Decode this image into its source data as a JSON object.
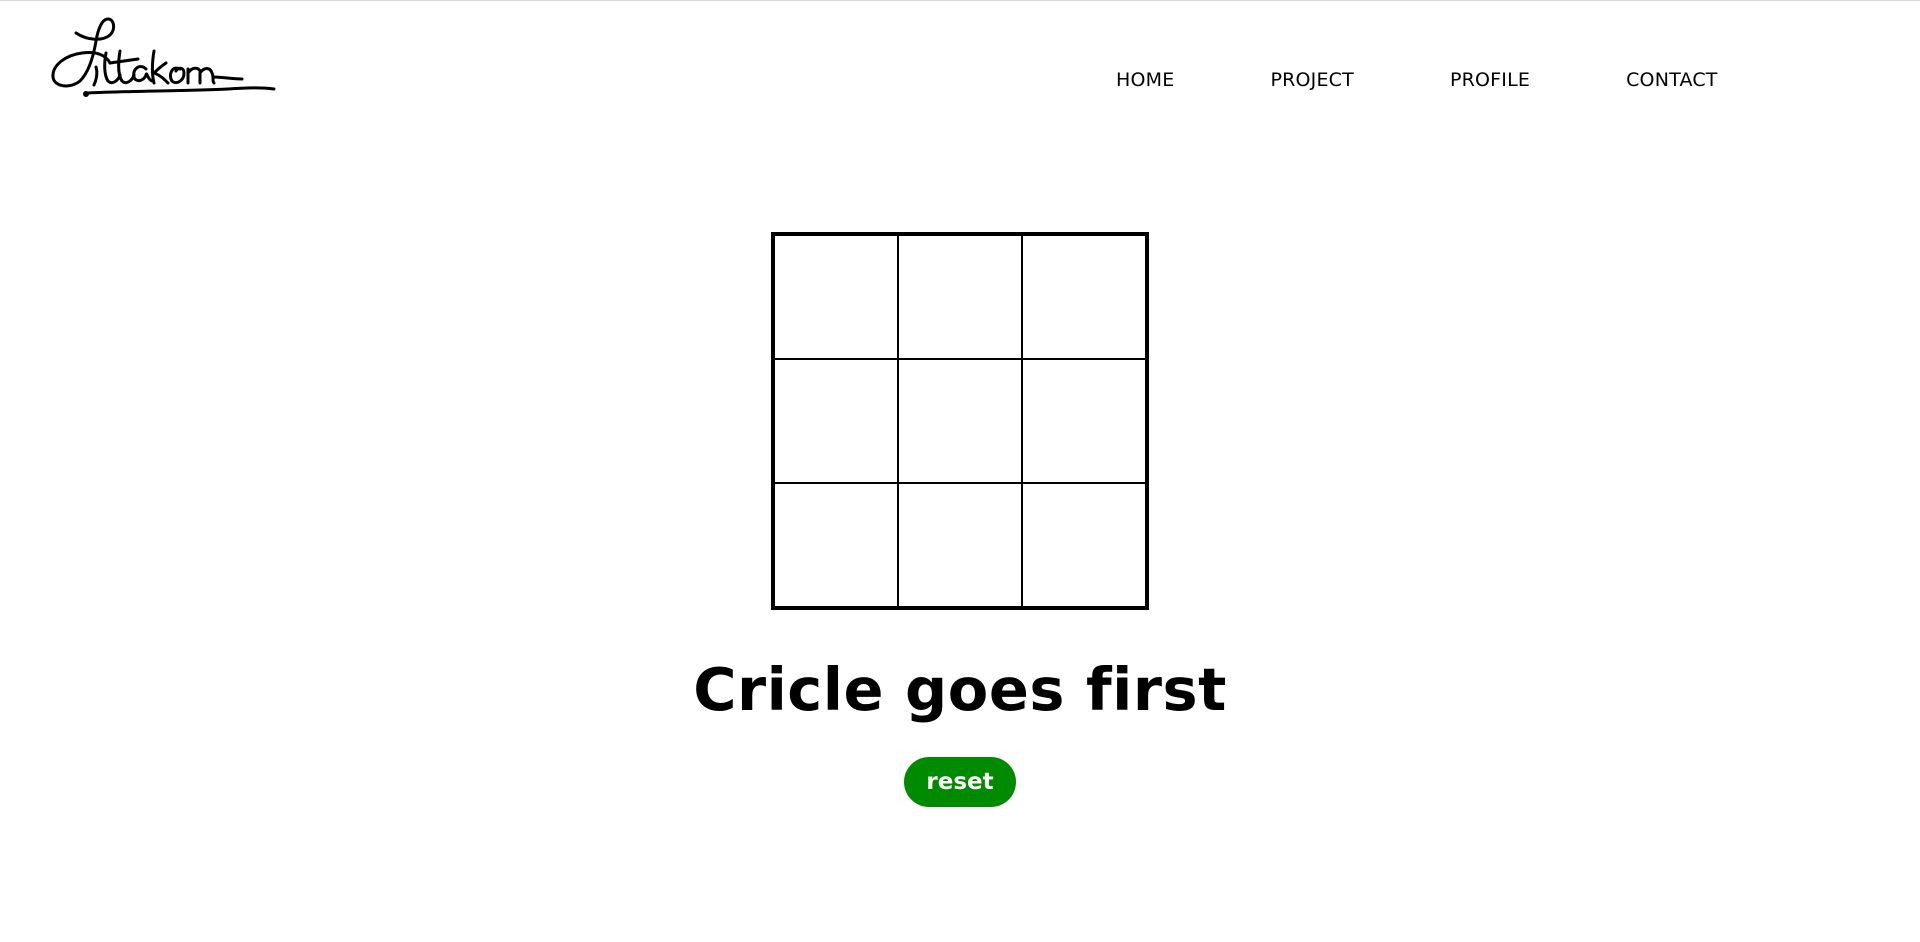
{
  "logo": {
    "icon": "signature-logo",
    "text": "Jittakorn"
  },
  "nav": {
    "items": [
      {
        "label": "HOME"
      },
      {
        "label": "PROJECT"
      },
      {
        "label": "PROFILE"
      },
      {
        "label": "CONTACT"
      }
    ]
  },
  "game": {
    "board": [
      [
        "",
        "",
        ""
      ],
      [
        "",
        "",
        ""
      ],
      [
        "",
        "",
        ""
      ]
    ],
    "status": "Cricle goes first",
    "reset_label": "reset"
  },
  "colors": {
    "accent": "#008a00",
    "text": "#000000",
    "background": "#ffffff"
  }
}
